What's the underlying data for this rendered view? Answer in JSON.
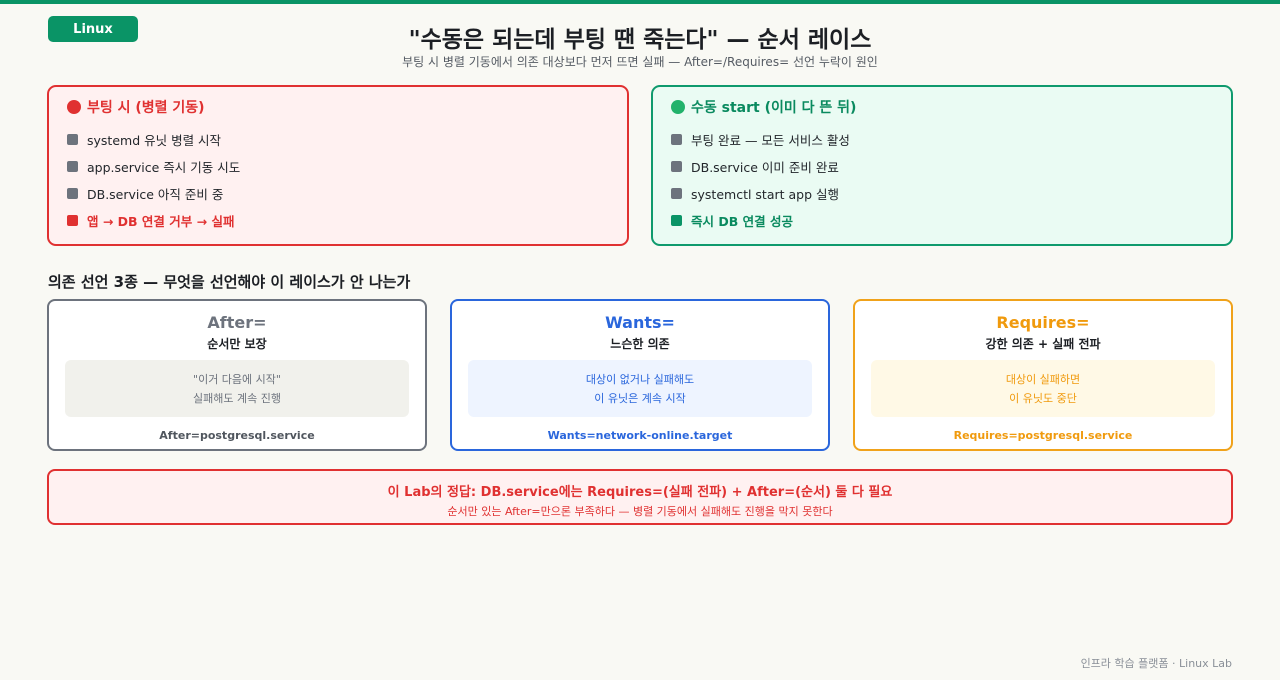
{
  "badge": "Linux",
  "title": "\"수동은 되는데 부팅 땐 죽는다\" — 순서 레이스",
  "subtitle": "부팅 시 병렬 기동에서 의존 대상보다 먼저 뜨면 실패 — After=/Requires= 선언 누락이 원인",
  "boot_panel": {
    "title": "부팅 시 (병렬 기동)",
    "steps": [
      "systemd 유닛 병렬 시작",
      "app.service 즉시 기동 시도",
      "DB.service 아직 준비 중",
      "앱 → DB 연결 거부 → 실패"
    ]
  },
  "manual_panel": {
    "title": "수동 start (이미 다 뜬 뒤)",
    "steps": [
      "부팅 완료 — 모든 서비스 활성",
      "DB.service 이미 준비 완료",
      "systemctl start app 실행",
      "즉시 DB 연결 성공"
    ]
  },
  "section_title": "의존 선언 3종 — 무엇을 선언해야 이 레이스가 안 나는가",
  "cards": [
    {
      "name": "After=",
      "desc": "순서만 보장",
      "line1": "\"이거 다음에 시작\"",
      "line2": "실패해도 계속 진행",
      "code": "After=postgresql.service"
    },
    {
      "name": "Wants=",
      "desc": "느슨한 의존",
      "line1": "대상이 없거나 실패해도",
      "line2": "이 유닛은 계속 시작",
      "code": "Wants=network-online.target"
    },
    {
      "name": "Requires=",
      "desc": "강한 의존 + 실패 전파",
      "line1": "대상이 실패하면",
      "line2": "이 유닛도 중단",
      "code": "Requires=postgresql.service"
    }
  ],
  "answer": {
    "main": "이 Lab의 정답: DB.service에는 Requires=(실패 전파) + After=(순서) 둘 다 필요",
    "sub": "순서만 있는 After=만으론 부족하다 — 병렬 기동에서 실패해도 진행을 막지 못한다"
  },
  "footer": "인프라 학습 플랫폼 · Linux Lab",
  "colors": {
    "accent": "#0a9466",
    "danger": "#e03131",
    "success": "#0f9a6d",
    "info": "#2a66dc",
    "warning": "#f0a21a",
    "neutral": "#6d737d"
  }
}
